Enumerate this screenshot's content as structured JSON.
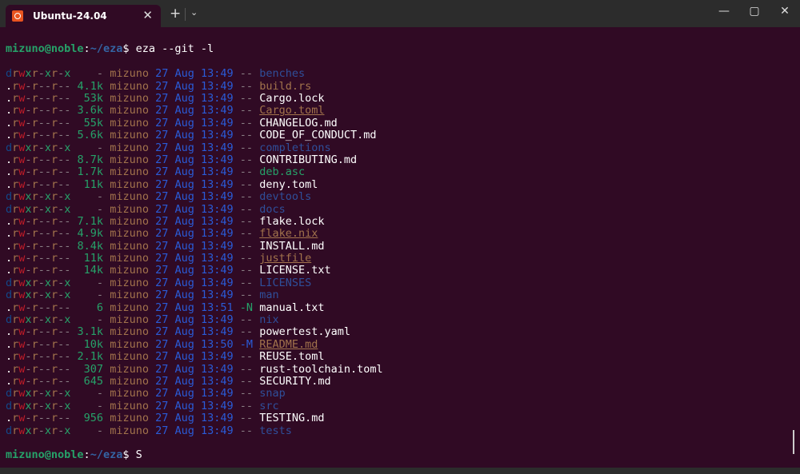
{
  "tab": {
    "title": "Ubuntu-24.04",
    "close": "✕",
    "new_tab": "+",
    "dropdown": "⌄"
  },
  "window": {
    "minimize": "—",
    "maximize": "▢",
    "close": "✕"
  },
  "prompt": {
    "userhost": "mizuno@noble",
    "colon": ":",
    "path": "~/eza",
    "dollar": "$",
    "command": " eza --git -l",
    "next_input": " S"
  },
  "colors": {
    "background": "#300a24",
    "prompt": "#26a269",
    "path": "#3465a4"
  },
  "rows": [
    {
      "perms": "drwxr-xr-x",
      "size": "-",
      "user": "mizuno",
      "date": "27 Aug 13:49",
      "git": "--",
      "name": "benches",
      "kind": "dir"
    },
    {
      "perms": ".rw-r--r--",
      "size": "4.1k",
      "user": "mizuno",
      "date": "27 Aug 13:49",
      "git": "--",
      "name": "build.rs",
      "kind": "src"
    },
    {
      "perms": ".rw-r--r--",
      "size": "53k",
      "user": "mizuno",
      "date": "27 Aug 13:49",
      "git": "--",
      "name": "Cargo.lock",
      "kind": "file"
    },
    {
      "perms": ".rw-r--r--",
      "size": "3.6k",
      "user": "mizuno",
      "date": "27 Aug 13:49",
      "git": "--",
      "name": "Cargo.toml",
      "kind": "build"
    },
    {
      "perms": ".rw-r--r--",
      "size": "55k",
      "user": "mizuno",
      "date": "27 Aug 13:49",
      "git": "--",
      "name": "CHANGELOG.md",
      "kind": "file"
    },
    {
      "perms": ".rw-r--r--",
      "size": "5.6k",
      "user": "mizuno",
      "date": "27 Aug 13:49",
      "git": "--",
      "name": "CODE_OF_CONDUCT.md",
      "kind": "file"
    },
    {
      "perms": "drwxr-xr-x",
      "size": "-",
      "user": "mizuno",
      "date": "27 Aug 13:49",
      "git": "--",
      "name": "completions",
      "kind": "dir"
    },
    {
      "perms": ".rw-r--r--",
      "size": "8.7k",
      "user": "mizuno",
      "date": "27 Aug 13:49",
      "git": "--",
      "name": "CONTRIBUTING.md",
      "kind": "file"
    },
    {
      "perms": ".rw-r--r--",
      "size": "1.7k",
      "user": "mizuno",
      "date": "27 Aug 13:49",
      "git": "--",
      "name": "deb.asc",
      "kind": "green"
    },
    {
      "perms": ".rw-r--r--",
      "size": "11k",
      "user": "mizuno",
      "date": "27 Aug 13:49",
      "git": "--",
      "name": "deny.toml",
      "kind": "file"
    },
    {
      "perms": "drwxr-xr-x",
      "size": "-",
      "user": "mizuno",
      "date": "27 Aug 13:49",
      "git": "--",
      "name": "devtools",
      "kind": "dir"
    },
    {
      "perms": "drwxr-xr-x",
      "size": "-",
      "user": "mizuno",
      "date": "27 Aug 13:49",
      "git": "--",
      "name": "docs",
      "kind": "dir"
    },
    {
      "perms": ".rw-r--r--",
      "size": "7.1k",
      "user": "mizuno",
      "date": "27 Aug 13:49",
      "git": "--",
      "name": "flake.lock",
      "kind": "file"
    },
    {
      "perms": ".rw-r--r--",
      "size": "4.9k",
      "user": "mizuno",
      "date": "27 Aug 13:49",
      "git": "--",
      "name": "flake.nix",
      "kind": "build"
    },
    {
      "perms": ".rw-r--r--",
      "size": "8.4k",
      "user": "mizuno",
      "date": "27 Aug 13:49",
      "git": "--",
      "name": "INSTALL.md",
      "kind": "file"
    },
    {
      "perms": ".rw-r--r--",
      "size": "11k",
      "user": "mizuno",
      "date": "27 Aug 13:49",
      "git": "--",
      "name": "justfile",
      "kind": "build"
    },
    {
      "perms": ".rw-r--r--",
      "size": "14k",
      "user": "mizuno",
      "date": "27 Aug 13:49",
      "git": "--",
      "name": "LICENSE.txt",
      "kind": "file"
    },
    {
      "perms": "drwxr-xr-x",
      "size": "-",
      "user": "mizuno",
      "date": "27 Aug 13:49",
      "git": "--",
      "name": "LICENSES",
      "kind": "dir"
    },
    {
      "perms": "drwxr-xr-x",
      "size": "-",
      "user": "mizuno",
      "date": "27 Aug 13:49",
      "git": "--",
      "name": "man",
      "kind": "dir"
    },
    {
      "perms": ".rw-r--r--",
      "size": "6",
      "user": "mizuno",
      "date": "27 Aug 13:51",
      "git": "-N",
      "name": "manual.txt",
      "kind": "file"
    },
    {
      "perms": "drwxr-xr-x",
      "size": "-",
      "user": "mizuno",
      "date": "27 Aug 13:49",
      "git": "--",
      "name": "nix",
      "kind": "dir"
    },
    {
      "perms": ".rw-r--r--",
      "size": "3.1k",
      "user": "mizuno",
      "date": "27 Aug 13:49",
      "git": "--",
      "name": "powertest.yaml",
      "kind": "file"
    },
    {
      "perms": ".rw-r--r--",
      "size": "10k",
      "user": "mizuno",
      "date": "27 Aug 13:50",
      "git": "-M",
      "name": "README.md",
      "kind": "build"
    },
    {
      "perms": ".rw-r--r--",
      "size": "2.1k",
      "user": "mizuno",
      "date": "27 Aug 13:49",
      "git": "--",
      "name": "REUSE.toml",
      "kind": "file"
    },
    {
      "perms": ".rw-r--r--",
      "size": "307",
      "user": "mizuno",
      "date": "27 Aug 13:49",
      "git": "--",
      "name": "rust-toolchain.toml",
      "kind": "file"
    },
    {
      "perms": ".rw-r--r--",
      "size": "645",
      "user": "mizuno",
      "date": "27 Aug 13:49",
      "git": "--",
      "name": "SECURITY.md",
      "kind": "file"
    },
    {
      "perms": "drwxr-xr-x",
      "size": "-",
      "user": "mizuno",
      "date": "27 Aug 13:49",
      "git": "--",
      "name": "snap",
      "kind": "dir"
    },
    {
      "perms": "drwxr-xr-x",
      "size": "-",
      "user": "mizuno",
      "date": "27 Aug 13:49",
      "git": "--",
      "name": "src",
      "kind": "dir"
    },
    {
      "perms": ".rw-r--r--",
      "size": "956",
      "user": "mizuno",
      "date": "27 Aug 13:49",
      "git": "--",
      "name": "TESTING.md",
      "kind": "file"
    },
    {
      "perms": "drwxr-xr-x",
      "size": "-",
      "user": "mizuno",
      "date": "27 Aug 13:49",
      "git": "--",
      "name": "tests",
      "kind": "dir"
    }
  ]
}
